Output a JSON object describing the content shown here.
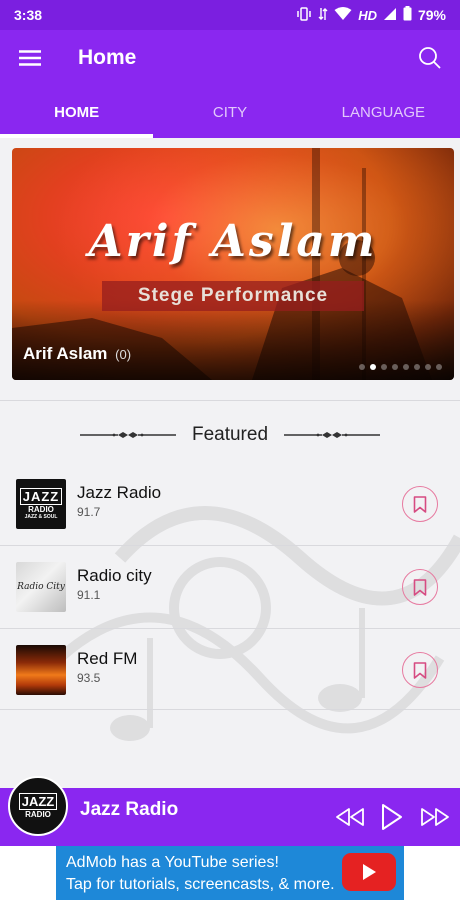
{
  "status_bar": {
    "time": "3:38",
    "network": "HD",
    "battery": "79%"
  },
  "app_bar": {
    "title": "Home"
  },
  "tabs": [
    {
      "label": "HOME",
      "active": true
    },
    {
      "label": "CITY",
      "active": false
    },
    {
      "label": "LANGUAGE",
      "active": false
    }
  ],
  "banner": {
    "art_title": "Arif Aslam",
    "art_subtitle": "Stege Performance",
    "caption_name": "Arif Aslam",
    "caption_count": "(0)",
    "slide_index": 2,
    "slide_total": 8
  },
  "featured": {
    "heading": "Featured"
  },
  "stations": [
    {
      "name": "Jazz Radio",
      "freq": "91.7",
      "thumb_icon": "jazz-radio-logo"
    },
    {
      "name": "Radio city",
      "freq": "91.1",
      "thumb_icon": "radio-city-logo"
    },
    {
      "name": "Red FM",
      "freq": "93.5",
      "thumb_icon": "red-fm-image"
    }
  ],
  "player": {
    "station_name": "Jazz Radio"
  },
  "thumb_logos": {
    "jazz_line1": "JAZZ",
    "jazz_line2": "RADIO",
    "jazz_line3": "JAZZ & SOUL",
    "city_text": "Radio City"
  },
  "ad": {
    "line1": "AdMob has a YouTube series!",
    "line2": "Tap for tutorials, screencasts, & more."
  },
  "colors": {
    "primary": "#8a27f0",
    "status_bar": "#7b1fe0",
    "accent_pink": "#e77aa0",
    "ad_blue": "#1e88d8"
  }
}
